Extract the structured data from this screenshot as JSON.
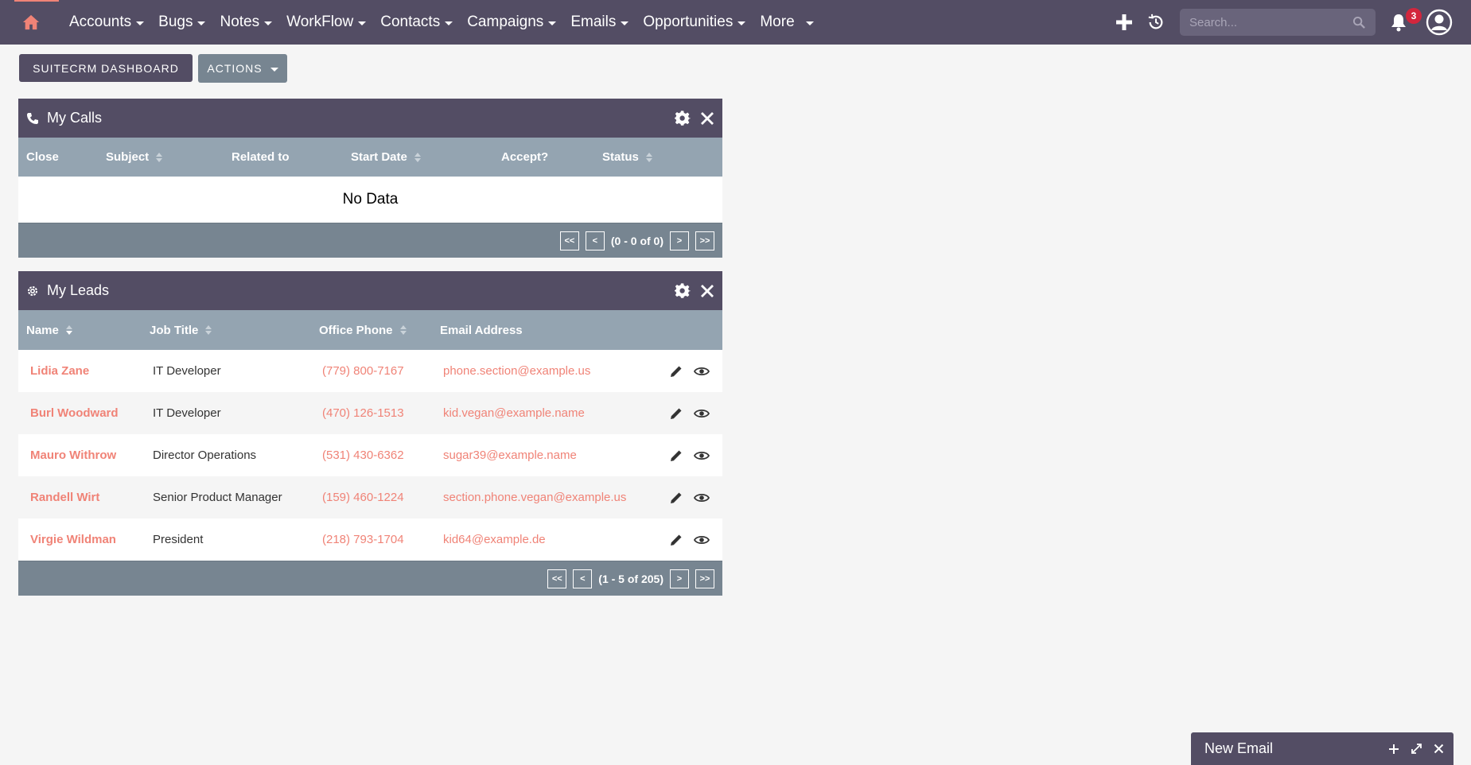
{
  "nav": {
    "items": [
      {
        "label": "Accounts"
      },
      {
        "label": "Bugs"
      },
      {
        "label": "Notes"
      },
      {
        "label": "WorkFlow"
      },
      {
        "label": "Contacts"
      },
      {
        "label": "Campaigns"
      },
      {
        "label": "Emails"
      },
      {
        "label": "Opportunities"
      },
      {
        "label": "More"
      }
    ],
    "search_placeholder": "Search...",
    "notification_count": "3"
  },
  "toolbar": {
    "dashboard_label": "SUITECRM DASHBOARD",
    "actions_label": "ACTIONS"
  },
  "calls": {
    "title": "My Calls",
    "columns": [
      "Close",
      "Subject",
      "Related to",
      "Start Date",
      "Accept?",
      "Status"
    ],
    "empty_text": "No Data",
    "pager": {
      "first": "<<",
      "prev": "<",
      "range": "(0 - 0 of 0)",
      "next": ">",
      "last": ">>"
    }
  },
  "leads": {
    "title": "My Leads",
    "columns": [
      "Name",
      "Job Title",
      "Office Phone",
      "Email Address"
    ],
    "rows": [
      {
        "name": "Lidia Zane",
        "title": "IT Developer",
        "phone": "(779) 800-7167",
        "email": "phone.section@example.us"
      },
      {
        "name": "Burl Woodward",
        "title": "IT Developer",
        "phone": "(470) 126-1513",
        "email": "kid.vegan@example.name"
      },
      {
        "name": "Mauro Withrow",
        "title": "Director Operations",
        "phone": "(531) 430-6362",
        "email": "sugar39@example.name"
      },
      {
        "name": "Randell Wirt",
        "title": "Senior Product Manager",
        "phone": "(159) 460-1224",
        "email": "section.phone.vegan@example.us"
      },
      {
        "name": "Virgie Wildman",
        "title": "President",
        "phone": "(218) 793-1704",
        "email": "kid64@example.de"
      }
    ],
    "pager": {
      "first": "<<",
      "prev": "<",
      "range": "(1 - 5 of 205)",
      "next": ">",
      "last": ">>"
    }
  },
  "new_email": {
    "title": "New Email"
  },
  "colors": {
    "header": "#534d64",
    "accent": "#f08377",
    "table_header": "#94a4b1",
    "footer": "#778591"
  }
}
